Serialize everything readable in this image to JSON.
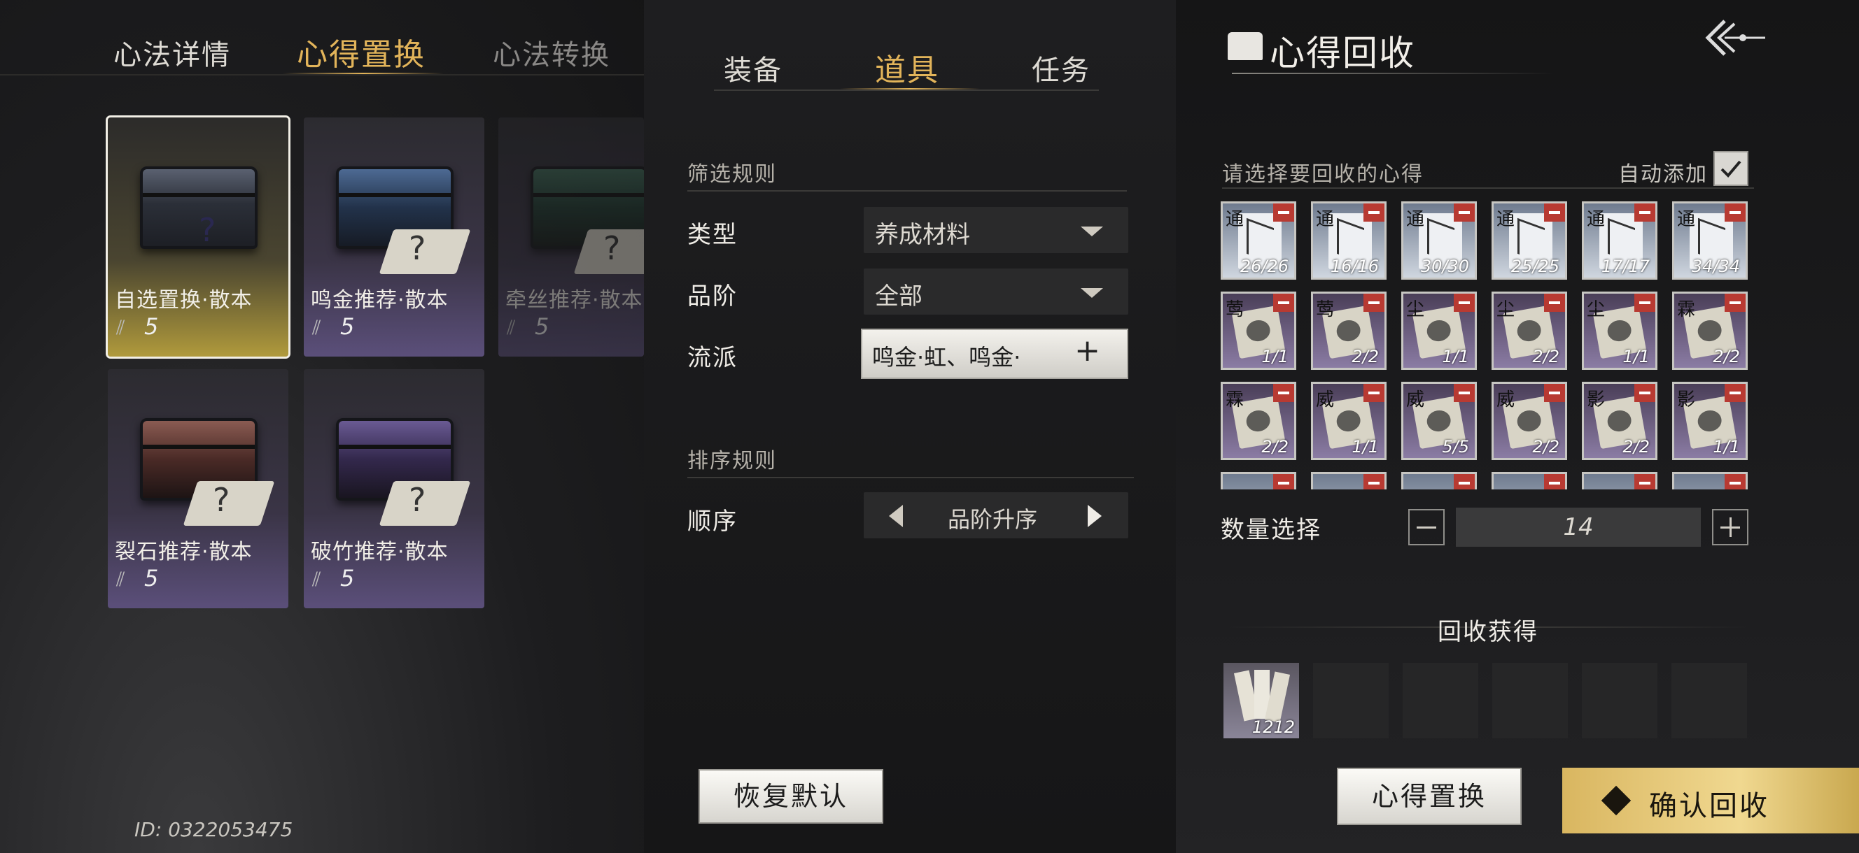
{
  "left_tabs": [
    "心法详情",
    "心得置换",
    "心法转换"
  ],
  "mid_tabs": [
    "装备",
    "道具",
    "任务"
  ],
  "cards": [
    {
      "name": "自选置换·散本",
      "count": "5"
    },
    {
      "name": "鸣金推荐·散本",
      "count": "5"
    },
    {
      "name": "牵丝推荐·散本",
      "count": "5"
    },
    {
      "name": "裂石推荐·散本",
      "count": "5"
    },
    {
      "name": "破竹推荐·散本",
      "count": "5"
    }
  ],
  "filter": {
    "title": "筛选规则",
    "type_label": "类型",
    "type_value": "养成材料",
    "grade_label": "品阶",
    "grade_value": "全部",
    "school_label": "流派",
    "school_value": "鸣金·虹、鸣金·",
    "plus": "+"
  },
  "sort": {
    "title": "排序规则",
    "order_label": "顺序",
    "order_value": "品阶升序"
  },
  "restore_button": "恢复默认",
  "user_id": "ID: 0322053475",
  "recycle": {
    "title": "心得回收",
    "prompt": "请选择要回收的心得",
    "auto_add": "自动添加",
    "qty_label": "数量选择",
    "qty_value": "14",
    "gain_title": "回收获得",
    "gain_count": "1212",
    "replace_button": "心得置换",
    "confirm_button": "确认回收"
  },
  "grid": [
    {
      "tag": "通",
      "count": "26/26",
      "kind": "blue"
    },
    {
      "tag": "通",
      "count": "16/16",
      "kind": "blue"
    },
    {
      "tag": "通",
      "count": "30/30",
      "kind": "blue"
    },
    {
      "tag": "通",
      "count": "25/25",
      "kind": "blue"
    },
    {
      "tag": "通",
      "count": "17/17",
      "kind": "blue"
    },
    {
      "tag": "通",
      "count": "34/34",
      "kind": "blue"
    },
    {
      "tag": "莺",
      "count": "1/1",
      "kind": "purple"
    },
    {
      "tag": "莺",
      "count": "2/2",
      "kind": "purple"
    },
    {
      "tag": "尘",
      "count": "1/1",
      "kind": "purple"
    },
    {
      "tag": "尘",
      "count": "2/2",
      "kind": "purple"
    },
    {
      "tag": "尘",
      "count": "1/1",
      "kind": "purple"
    },
    {
      "tag": "霖",
      "count": "2/2",
      "kind": "purple"
    },
    {
      "tag": "霖",
      "count": "2/2",
      "kind": "purple"
    },
    {
      "tag": "威",
      "count": "1/1",
      "kind": "purple"
    },
    {
      "tag": "威",
      "count": "5/5",
      "kind": "purple"
    },
    {
      "tag": "威",
      "count": "2/2",
      "kind": "purple"
    },
    {
      "tag": "影",
      "count": "2/2",
      "kind": "purple"
    },
    {
      "tag": "影",
      "count": "1/1",
      "kind": "purple"
    }
  ]
}
